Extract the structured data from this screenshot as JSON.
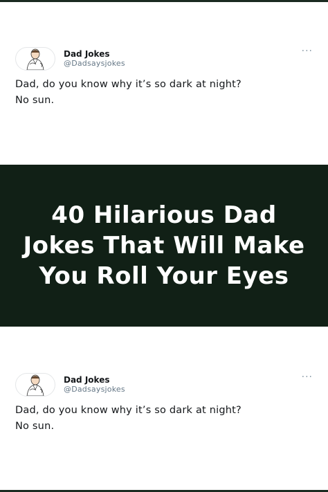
{
  "tweets": [
    {
      "display_name": "Dad Jokes",
      "handle": "@Dadsaysjokes",
      "text_line1": "Dad, do you know why it’s so dark at night?",
      "text_line2": "No sun.",
      "more_icon": "ellipsis-icon",
      "avatar_icon": "cartoon-dad-avatar-icon"
    },
    {
      "display_name": "Dad Jokes",
      "handle": "@Dadsaysjokes",
      "text_line1": "Dad, do you know why it’s so dark at night?",
      "text_line2": "No sun.",
      "more_icon": "ellipsis-icon",
      "avatar_icon": "cartoon-dad-avatar-icon"
    }
  ],
  "banner": {
    "title": "40 Hilarious Dad Jokes That Will Make You Roll Your Eyes",
    "background_color": "#112016",
    "text_color": "#ffffff"
  },
  "more_glyph": "···"
}
